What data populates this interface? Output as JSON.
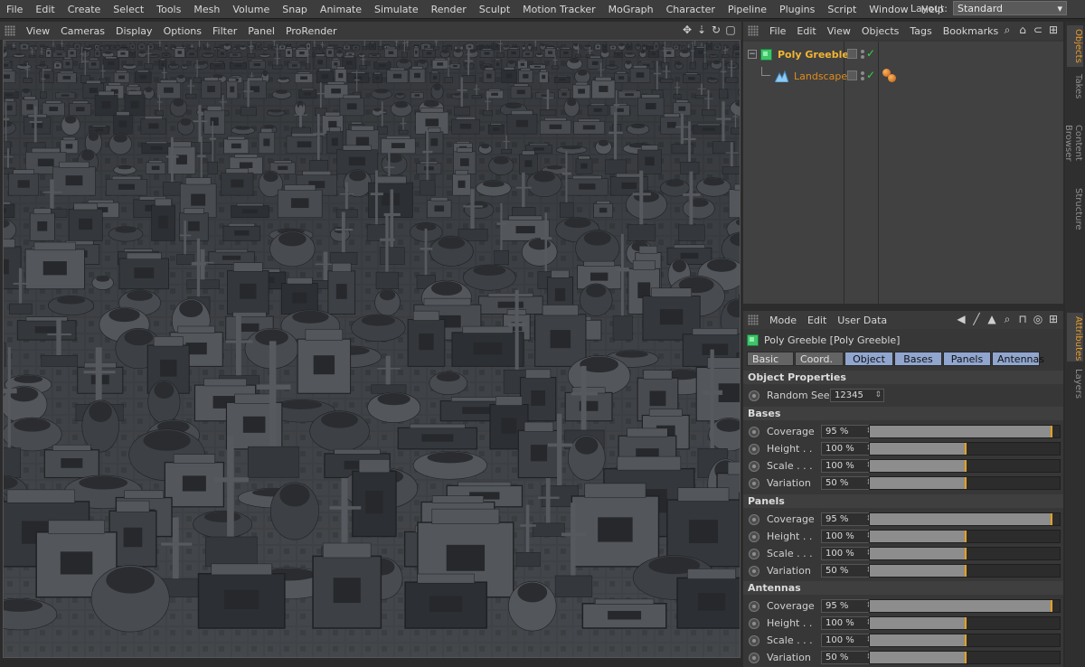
{
  "menu": [
    "File",
    "Edit",
    "Create",
    "Select",
    "Tools",
    "Mesh",
    "Volume",
    "Snap",
    "Animate",
    "Simulate",
    "Render",
    "Sculpt",
    "Motion Tracker",
    "MoGraph",
    "Character",
    "Pipeline",
    "Plugins",
    "Script",
    "Window",
    "Help"
  ],
  "layout": {
    "label": "Layout:",
    "value": "Standard"
  },
  "viewport_menu": [
    "View",
    "Cameras",
    "Display",
    "Options",
    "Filter",
    "Panel",
    "ProRender"
  ],
  "object_manager": {
    "menu": [
      "File",
      "Edit",
      "View",
      "Objects",
      "Tags",
      "Bookmarks"
    ],
    "objects": [
      {
        "name": "Poly Greeble",
        "color": "#f2b632"
      },
      {
        "name": "Landscape",
        "color": "#e08c1c"
      }
    ]
  },
  "side_tabs_top": [
    "Objects",
    "Takes",
    "Content Browser",
    "Structure"
  ],
  "side_tabs_bottom": [
    "Attributes",
    "Layers"
  ],
  "attribute_manager": {
    "menu": [
      "Mode",
      "Edit",
      "User Data"
    ],
    "title": "Poly Greeble [Poly Greeble]",
    "tabs": [
      "Basic",
      "Coord.",
      "Object",
      "Bases",
      "Panels",
      "Antennas"
    ],
    "selected_tabs": [
      "Object",
      "Bases",
      "Panels",
      "Antennas"
    ],
    "object_properties": {
      "title": "Object Properties",
      "random_seed_label": "Random Seed",
      "random_seed_value": "12345"
    },
    "groups": [
      {
        "title": "Bases",
        "params": [
          {
            "label": "Coverage",
            "value": "95 %",
            "level": 0.95
          },
          {
            "label": "Height . .",
            "value": "100 %",
            "level": 0.5
          },
          {
            "label": "Scale . . .",
            "value": "100 %",
            "level": 0.5
          },
          {
            "label": "Variation",
            "value": "50 %",
            "level": 0.5
          }
        ]
      },
      {
        "title": "Panels",
        "params": [
          {
            "label": "Coverage",
            "value": "95 %",
            "level": 0.95
          },
          {
            "label": "Height . .",
            "value": "100 %",
            "level": 0.5
          },
          {
            "label": "Scale . . .",
            "value": "100 %",
            "level": 0.5
          },
          {
            "label": "Variation",
            "value": "50 %",
            "level": 0.5
          }
        ]
      },
      {
        "title": "Antennas",
        "params": [
          {
            "label": "Coverage",
            "value": "95 %",
            "level": 0.95
          },
          {
            "label": "Height . .",
            "value": "100 %",
            "level": 0.5
          },
          {
            "label": "Scale . . .",
            "value": "100 %",
            "level": 0.5
          },
          {
            "label": "Variation",
            "value": "50 %",
            "level": 0.5
          }
        ]
      }
    ]
  },
  "colors": {
    "accent": "#e69b2c",
    "slider_knob": "#e8a11a",
    "tab_selected": "#90a6cf"
  }
}
